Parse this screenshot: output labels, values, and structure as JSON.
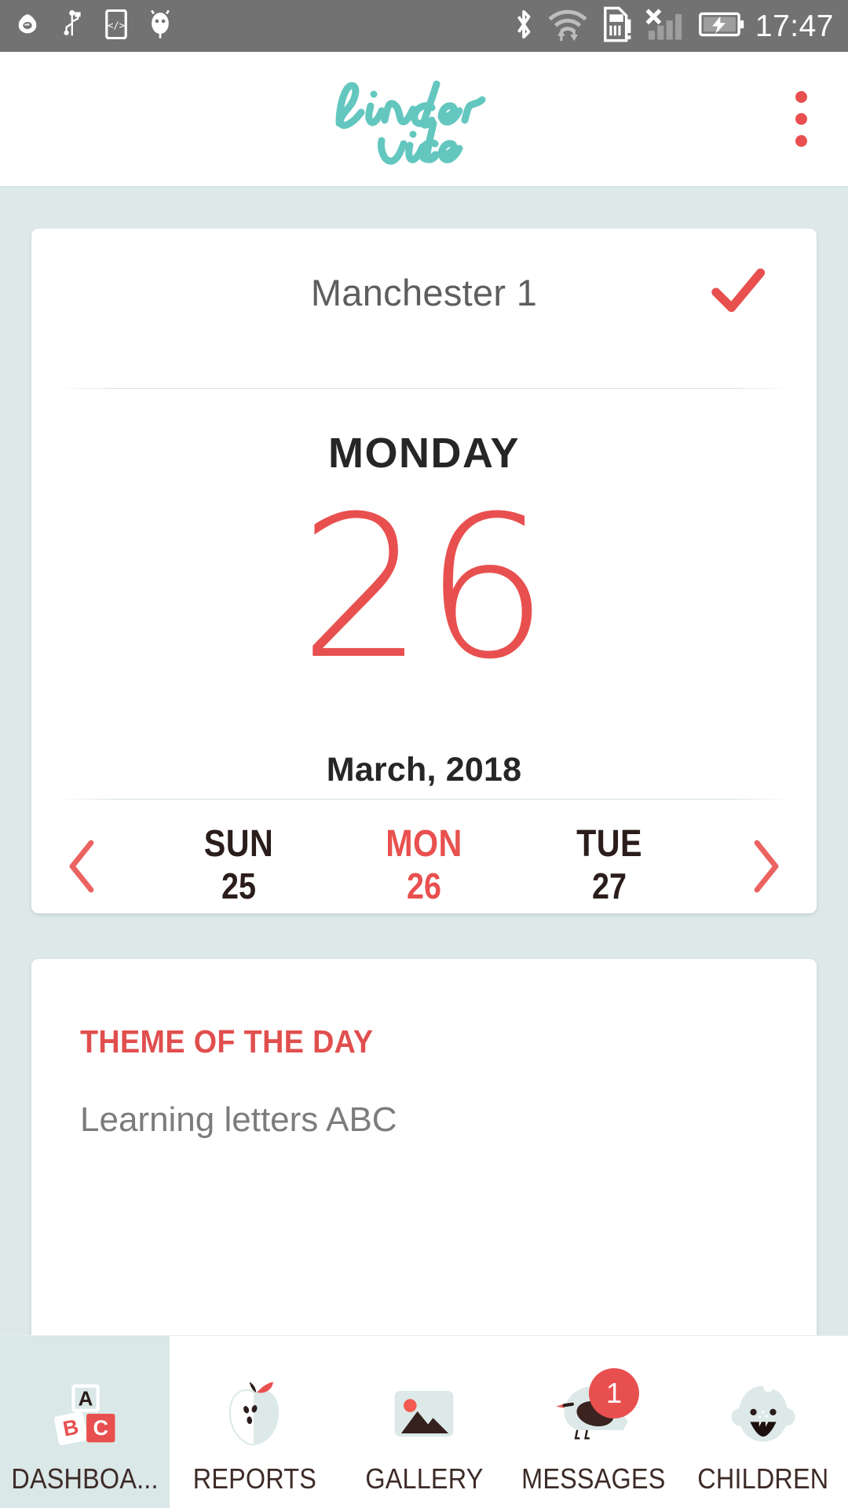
{
  "status_bar": {
    "time": "17:47",
    "left_icons": [
      "app-notification-icon",
      "usb-icon",
      "developer-code-icon",
      "android-debug-icon"
    ],
    "right_icons": [
      "bluetooth-icon",
      "wifi-transfer-icon",
      "sim-card-alert-icon",
      "no-signal-icon",
      "battery-charging-icon"
    ]
  },
  "app_bar": {
    "logo_line1": "kinder",
    "logo_line2": "vibe",
    "logo_color": "#63c7bf",
    "overflow_label": "More options",
    "accent": "#e8504f"
  },
  "calendar_card": {
    "site_name": "Manchester 1",
    "check_label": "Confirmed",
    "weekday": "MONDAY",
    "day_number": "26",
    "month_year": "March, 2018",
    "prev_label": "Previous day",
    "next_label": "Next day",
    "days": [
      {
        "dow": "SUN",
        "num": "25",
        "selected": false
      },
      {
        "dow": "MON",
        "num": "26",
        "selected": true
      },
      {
        "dow": "TUE",
        "num": "27",
        "selected": false
      }
    ]
  },
  "theme_card": {
    "label": "THEME OF THE DAY",
    "text": "Learning letters ABC"
  },
  "bottom_nav": {
    "items": [
      {
        "label": "DASHBOA...",
        "icon": "abc-blocks-icon",
        "active": true,
        "badge": null
      },
      {
        "label": "REPORTS",
        "icon": "apple-icon",
        "active": false,
        "badge": null
      },
      {
        "label": "GALLERY",
        "icon": "photo-icon",
        "active": false,
        "badge": null
      },
      {
        "label": "MESSAGES",
        "icon": "bird-icon",
        "active": false,
        "badge": "1"
      },
      {
        "label": "CHILDREN",
        "icon": "baby-face-icon",
        "active": false,
        "badge": null
      }
    ]
  },
  "colors": {
    "background": "#dde9e8",
    "card": "#ffffff",
    "accent_red": "#e8504f",
    "teal": "#63c7bf",
    "status_bar": "#727272"
  }
}
